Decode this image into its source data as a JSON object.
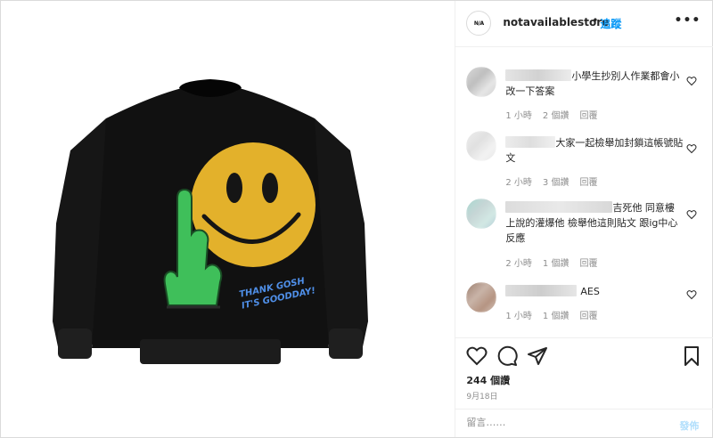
{
  "header": {
    "logo_text": "N/A",
    "username": "notavailablestore",
    "separator": "•",
    "follow_label": "追蹤",
    "more_label": "•••"
  },
  "media": {
    "print_text_line1": "THANK GOSH",
    "print_text_line2": "IT'S GOODDAY!"
  },
  "comments": [
    {
      "text": "小學生抄別人作業都會小改一下答案",
      "time": "1 小時",
      "likes": "2 個讚",
      "reply": "回覆",
      "avatar_colors": [
        "#d9d9d9",
        "#bfbfbf",
        "#e6e6e6",
        "#cfcfcf"
      ]
    },
    {
      "text": "大家一起檢舉加封鎖這帳號貼文",
      "time": "2 小時",
      "likes": "3 個讚",
      "reply": "回覆",
      "avatar_colors": [
        "#eeeeee",
        "#e0e0e0",
        "#f2f2f2",
        "#e8e8e8"
      ]
    },
    {
      "text": "吉死他 同意樓上說的灌爆他 檢舉他這則貼文 跟ig中心反應",
      "time": "2 小時",
      "likes": "1 個讚",
      "reply": "回覆",
      "avatar_colors": [
        "#a8d8d0",
        "#c7d6d6",
        "#d2e8e4",
        "#b5cfd8"
      ]
    },
    {
      "text": "AES",
      "time": "1 小時",
      "likes": "1 個讚",
      "reply": "回覆",
      "avatar_colors": [
        "#9c7e6e",
        "#c9b4a8",
        "#b59482",
        "#d6c7bd"
      ]
    }
  ],
  "actions": {
    "likes": "244 個讚",
    "date": "9月18日"
  },
  "add_comment": {
    "placeholder": "留言……",
    "post_label": "發佈"
  }
}
